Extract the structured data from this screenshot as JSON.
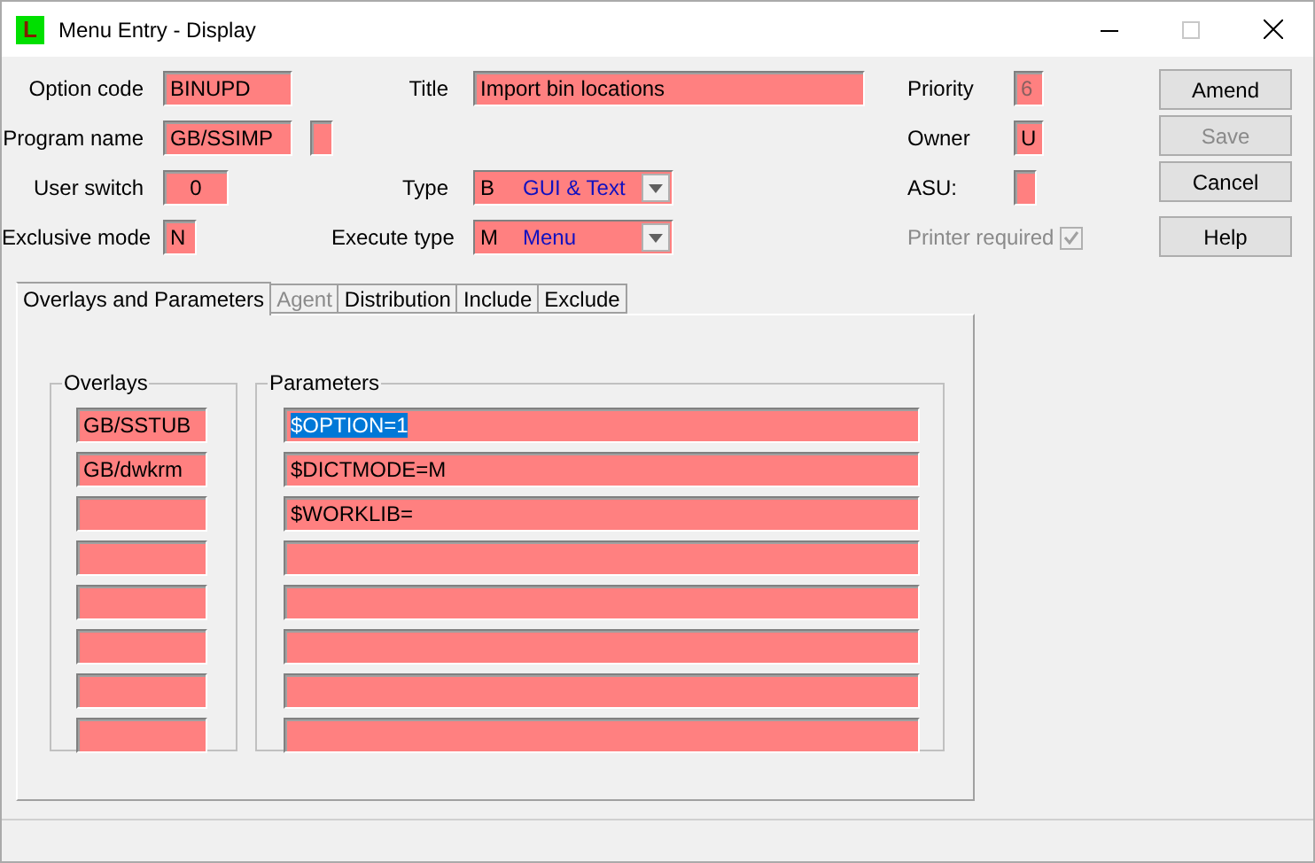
{
  "window": {
    "icon_letter": "L",
    "title": "Menu Entry - Display"
  },
  "left_fields": [
    {
      "kind": "text",
      "label": "Option code",
      "value": "BINUPD"
    },
    {
      "kind": "text_extra",
      "label": "Program name",
      "value": "GB/SSIMP"
    },
    {
      "kind": "number",
      "label": "User switch",
      "value": "0"
    },
    {
      "kind": "flag",
      "label": "Exclusive mode",
      "value": "N"
    }
  ],
  "middle_fields": [
    {
      "kind": "text",
      "label": "Title",
      "value": "Import bin locations"
    },
    {
      "kind": "blank"
    },
    {
      "kind": "combo",
      "label": "Type",
      "code": "B",
      "value": "GUI & Text"
    },
    {
      "kind": "combo",
      "label": "Execute type",
      "code": "M",
      "value": "Menu"
    }
  ],
  "right_fields": [
    {
      "kind": "text",
      "label": "Priority",
      "value": "6",
      "disabled": true
    },
    {
      "kind": "text",
      "label": "Owner",
      "value": "U",
      "disabled": false
    },
    {
      "kind": "text",
      "label": "ASU:"
    },
    {
      "kind": "checkbox",
      "label": "Printer required",
      "checked": true,
      "disabled": true
    }
  ],
  "buttons": [
    {
      "label": "Amend",
      "disabled": false
    },
    {
      "label": "Save",
      "disabled": true
    },
    {
      "label": "Cancel",
      "disabled": false
    },
    {
      "label": "Help",
      "disabled": false
    }
  ],
  "tabs": [
    {
      "label": "Overlays and Parameters",
      "selected": true,
      "disabled": false
    },
    {
      "label": "Agent",
      "selected": false,
      "disabled": true
    },
    {
      "label": "Distribution",
      "selected": false,
      "disabled": false
    },
    {
      "label": "Include",
      "selected": false,
      "disabled": false
    },
    {
      "label": "Exclude",
      "selected": false,
      "disabled": false
    }
  ],
  "overlays": {
    "title": "Overlays",
    "items": [
      {
        "kind": "filled",
        "value": "GB/SSTUB"
      },
      {
        "kind": "filled",
        "value": "GB/dwkrm"
      },
      {
        "kind": "empty"
      },
      {
        "kind": "empty"
      },
      {
        "kind": "empty"
      },
      {
        "kind": "empty"
      },
      {
        "kind": "empty"
      },
      {
        "kind": "empty"
      }
    ]
  },
  "parameters": {
    "title": "Parameters",
    "items": [
      {
        "kind": "filled",
        "value": "$OPTION=1",
        "highlighted": true
      },
      {
        "kind": "filled",
        "value": "$DICTMODE=M",
        "highlighted": false
      },
      {
        "kind": "filled",
        "value": "$WORKLIB=",
        "highlighted": false
      },
      {
        "kind": "empty"
      },
      {
        "kind": "empty"
      },
      {
        "kind": "empty"
      },
      {
        "kind": "empty"
      },
      {
        "kind": "empty"
      }
    ]
  }
}
